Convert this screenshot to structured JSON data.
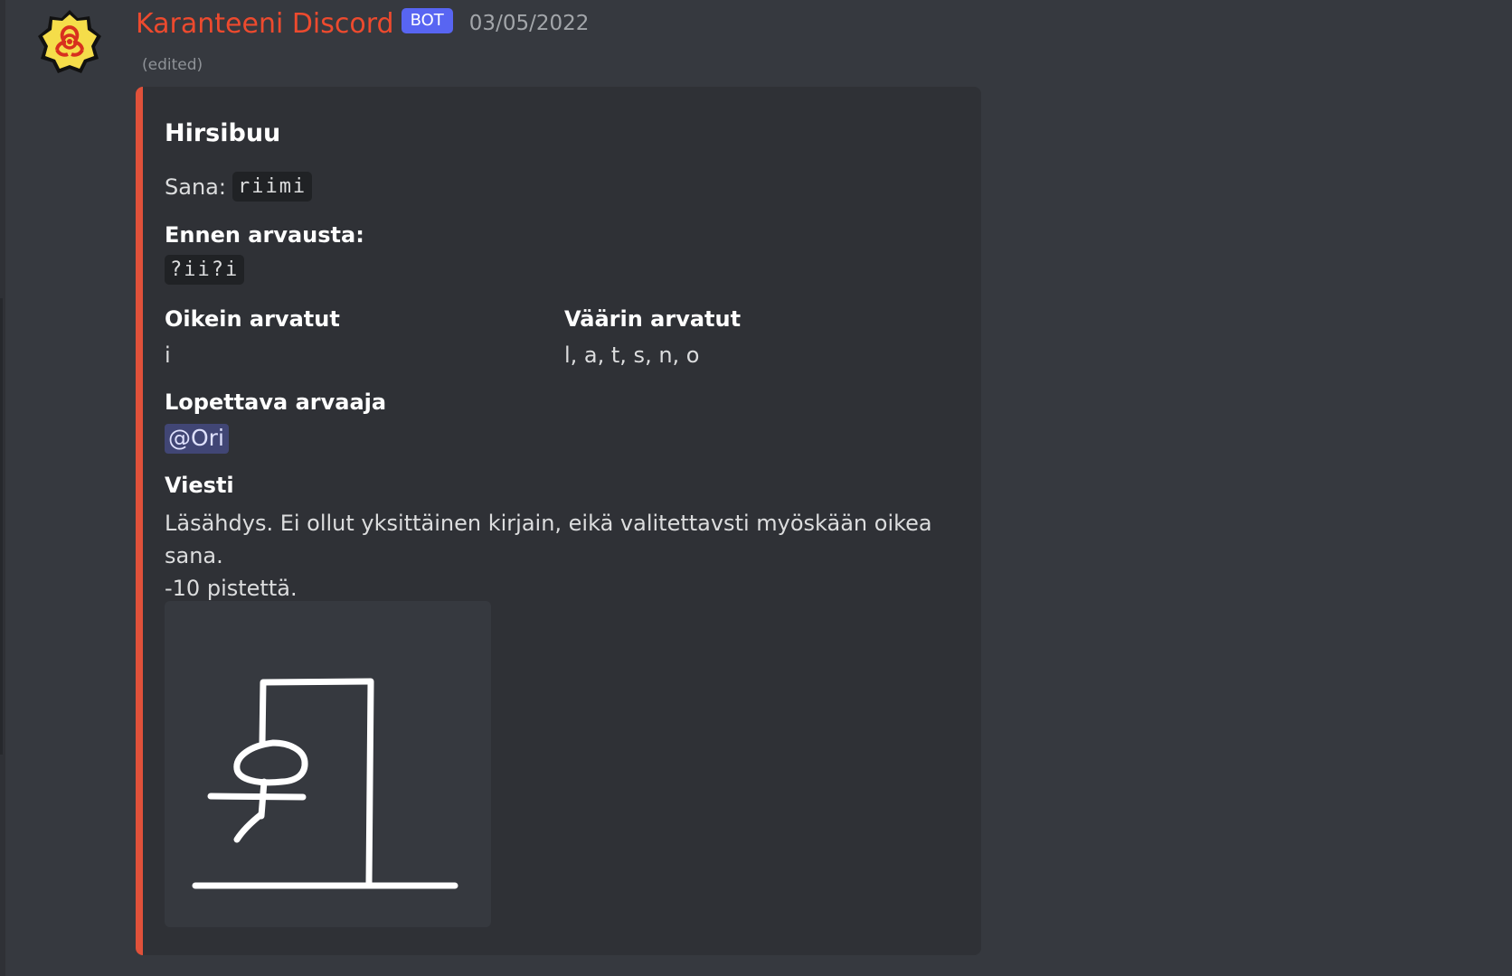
{
  "message": {
    "author": "Karanteeni Discord",
    "bot_badge": "BOT",
    "timestamp": "03/05/2022",
    "edited": "(edited)",
    "avatar_icon": "biohazard-icon",
    "author_color": "#ed4a2e"
  },
  "embed": {
    "accent_color": "#e0513a",
    "title": "Hirsibuu",
    "description_label": "Sana:",
    "description_word": "riimi",
    "fields": {
      "before_guess": {
        "name": "Ennen arvausta:",
        "value": "?ii?i"
      },
      "correct": {
        "name": "Oikein arvatut",
        "value": "i"
      },
      "wrong": {
        "name": "Väärin arvatut",
        "value": "l, a, t, s, n, o"
      },
      "finisher": {
        "name": "Lopettava arvaaja",
        "value": "@Ori"
      },
      "message": {
        "name": "Viesti",
        "line1": "Läsähdys. Ei ollut yksittäinen kirjain, eikä valitettavsti myöskään oikea sana.",
        "line2": "-10 pistettä."
      }
    },
    "image_icon": "hangman-drawing-icon"
  }
}
